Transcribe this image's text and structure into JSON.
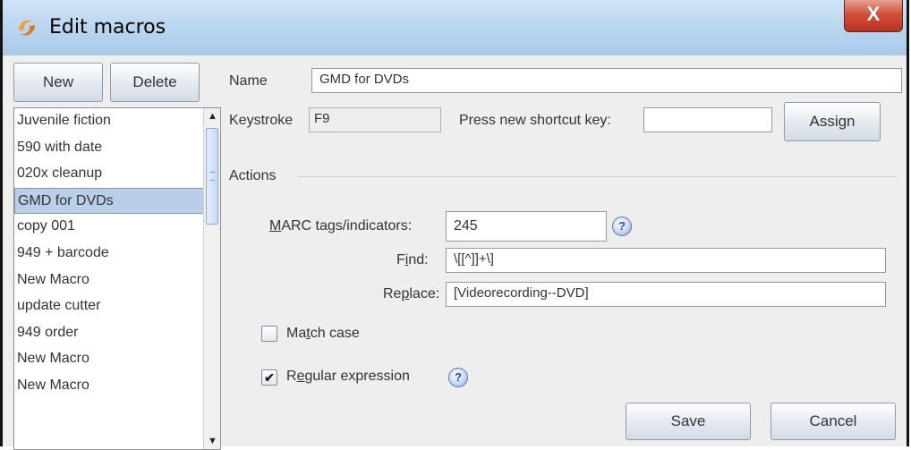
{
  "window": {
    "title": "Edit macros",
    "close_glyph": "X"
  },
  "list_toolbar": {
    "new_label": "New",
    "delete_label": "Delete"
  },
  "macros": [
    "Juvenile fiction",
    "590 with date",
    "020x cleanup",
    "GMD for DVDs",
    "copy 001",
    "949 + barcode",
    "New Macro",
    "update cutter",
    "949 order",
    "New Macro",
    "New Macro"
  ],
  "selected_macro": "GMD for DVDs",
  "name": {
    "label": "Name",
    "value": "GMD for DVDs"
  },
  "keystroke": {
    "label": "Keystroke",
    "value": "F9",
    "new_shortcut_label": "Press new shortcut key:",
    "new_shortcut_value": "",
    "assign_label": "Assign"
  },
  "actions": {
    "section_label": "Actions",
    "marc_tags_label_pre": "",
    "marc_tags_mnemonic": "M",
    "marc_tags_label_post": "ARC tags/indicators:",
    "marc_tags_value": "245",
    "find_label_pre": "F",
    "find_mnemonic": "i",
    "find_label_post": "nd:",
    "find_value": "\\[[^]]+\\]",
    "replace_label_pre": "Re",
    "replace_mnemonic": "p",
    "replace_label_post": "lace:",
    "replace_value": "[Videorecording--DVD]",
    "match_case_label_pre": "Ma",
    "match_case_mnemonic": "t",
    "match_case_label_post": "ch case",
    "match_case_checked": false,
    "regex_label_pre": "R",
    "regex_mnemonic": "e",
    "regex_label_post": "gular expression",
    "regex_checked": true,
    "check_glyph": "✔",
    "help_glyph": "?"
  },
  "footer": {
    "save_label": "Save",
    "cancel_label": "Cancel"
  },
  "colors": {
    "selection": "#b9cfe8",
    "close_button": "#c9432f",
    "titlebar": "#bcd7f0"
  }
}
